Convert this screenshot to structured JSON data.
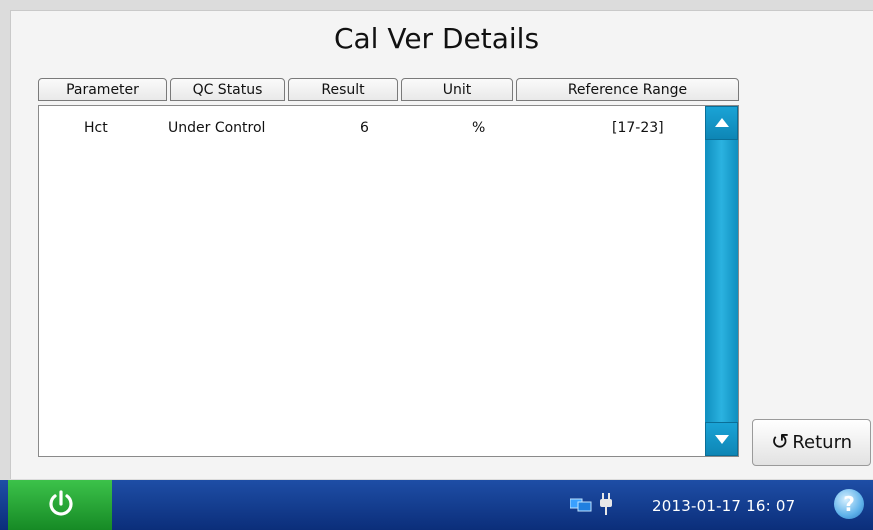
{
  "page_title": "Cal Ver Details",
  "table": {
    "headers": {
      "parameter": "Parameter",
      "qc_status": "QC Status",
      "result": "Result",
      "unit": "Unit",
      "reference_range": "Reference Range"
    },
    "rows": [
      {
        "parameter": "Hct",
        "qc_status": "Under Control",
        "result": "6",
        "unit": "%",
        "reference_range": "[17-23]"
      }
    ]
  },
  "buttons": {
    "return_label": "Return"
  },
  "taskbar": {
    "date": "2013-01-17",
    "time": "16: 07",
    "help_label": "?"
  },
  "icons": {
    "power": "power-icon",
    "network": "network-icon",
    "plug": "plug-icon",
    "help": "help-icon",
    "return": "return-icon"
  },
  "colors": {
    "scrollbar": "#1aa3d6",
    "taskbar": "#16419a",
    "power_button": "#2aa73a"
  }
}
